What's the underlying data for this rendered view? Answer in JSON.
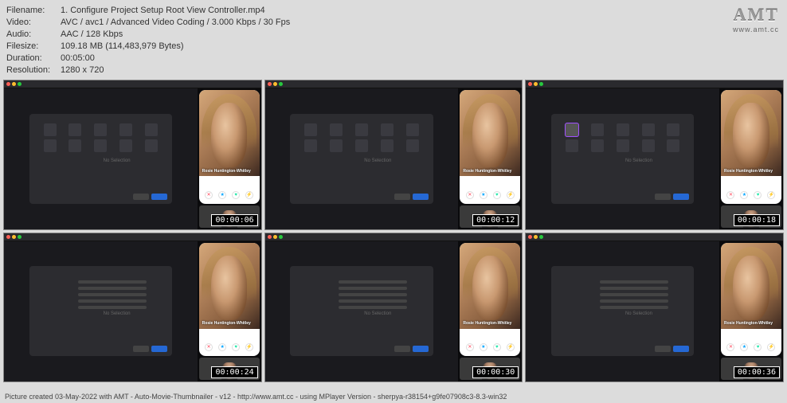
{
  "meta": {
    "filename_label": "Filename:",
    "filename_value": "1. Configure Project  Setup Root View Controller.mp4",
    "video_label": "Video:",
    "video_value": "AVC / avc1 / Advanced Video Coding / 3.000 Kbps / 30 Fps",
    "audio_label": "Audio:",
    "audio_value": "AAC / 128 Kbps",
    "filesize_label": "Filesize:",
    "filesize_value": "109.18 MB (114,483,979 Bytes)",
    "duration_label": "Duration:",
    "duration_value": "00:05:00",
    "resolution_label": "Resolution:",
    "resolution_value": "1280 x 720"
  },
  "logo": {
    "text": "AMT",
    "sub": "www.amt.cc"
  },
  "thumbs": [
    {
      "timestamp": "00:00:06",
      "dialog_type": "icons",
      "active_icon": false
    },
    {
      "timestamp": "00:00:12",
      "dialog_type": "icons",
      "active_icon": false
    },
    {
      "timestamp": "00:00:18",
      "dialog_type": "icons",
      "active_icon": true
    },
    {
      "timestamp": "00:00:24",
      "dialog_type": "form",
      "active_icon": false
    },
    {
      "timestamp": "00:00:30",
      "dialog_type": "form",
      "active_icon": false
    },
    {
      "timestamp": "00:00:36",
      "dialog_type": "form",
      "active_icon": false
    }
  ],
  "phone": {
    "name": "Rosie Huntington-Whitley"
  },
  "side_text": "No Selection",
  "footer": "Picture created 03-May-2022 with AMT - Auto-Movie-Thumbnailer - v12 - http://www.amt.cc - using MPlayer Version - sherpya-r38154+g9fe07908c3-8.3-win32"
}
